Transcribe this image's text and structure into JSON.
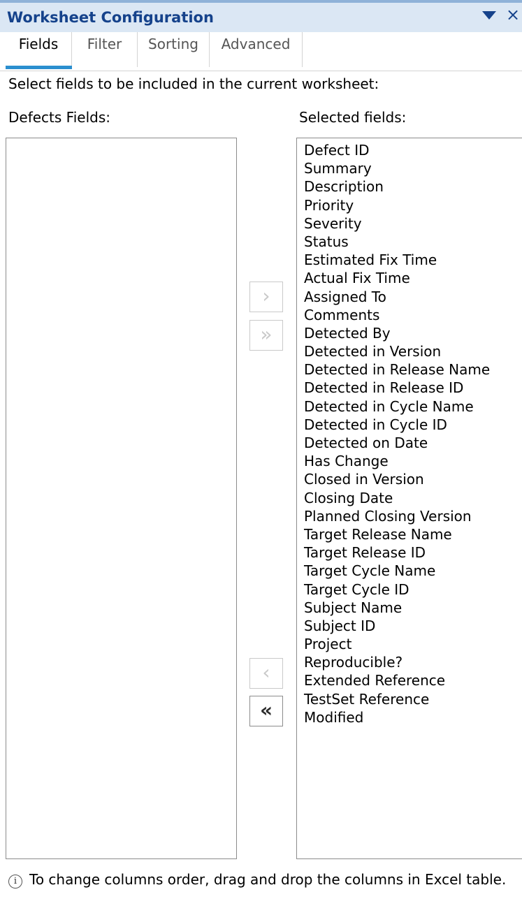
{
  "window": {
    "title": "Worksheet Configuration",
    "dropdown_icon": "triangle-down-icon",
    "close_icon": "close-icon",
    "close_glyph": "×"
  },
  "tabs": [
    {
      "label": "Fields",
      "active": true
    },
    {
      "label": "Filter",
      "active": false
    },
    {
      "label": "Sorting",
      "active": false
    },
    {
      "label": "Advanced",
      "active": false
    }
  ],
  "main": {
    "intro": "Select fields to be included in the current worksheet:",
    "available_label": "Defects Fields:",
    "selected_label": "Selected fields:",
    "available_fields": [],
    "selected_fields": [
      "Defect ID",
      "Summary",
      "Description",
      "Priority",
      "Severity",
      "Status",
      "Estimated Fix Time",
      "Actual Fix Time",
      "Assigned To",
      "Comments",
      "Detected By",
      "Detected in Version",
      "Detected in Release Name",
      "Detected in Release ID",
      "Detected in Cycle Name",
      "Detected in Cycle ID",
      "Detected on Date",
      "Has Change",
      "Closed in Version",
      "Closing Date",
      "Planned Closing Version",
      "Target Release Name",
      "Target Release ID",
      "Target Cycle Name",
      "Target Cycle ID",
      "Subject Name",
      "Subject ID",
      "Project",
      "Reproducible?",
      "Extended Reference",
      "TestSet Reference",
      "Modified"
    ]
  },
  "buttons": {
    "add_one": "›",
    "add_all": "»",
    "remove_one": "‹",
    "remove_all": "«"
  },
  "footer": {
    "info_icon": "info-icon",
    "info_glyph": "i",
    "text": "To change columns order, drag and drop the columns in Excel table."
  },
  "colors": {
    "title_text": "#15428b",
    "titlebar_bg": "#dbe7f4",
    "tab_accent": "#2b8fcf"
  }
}
